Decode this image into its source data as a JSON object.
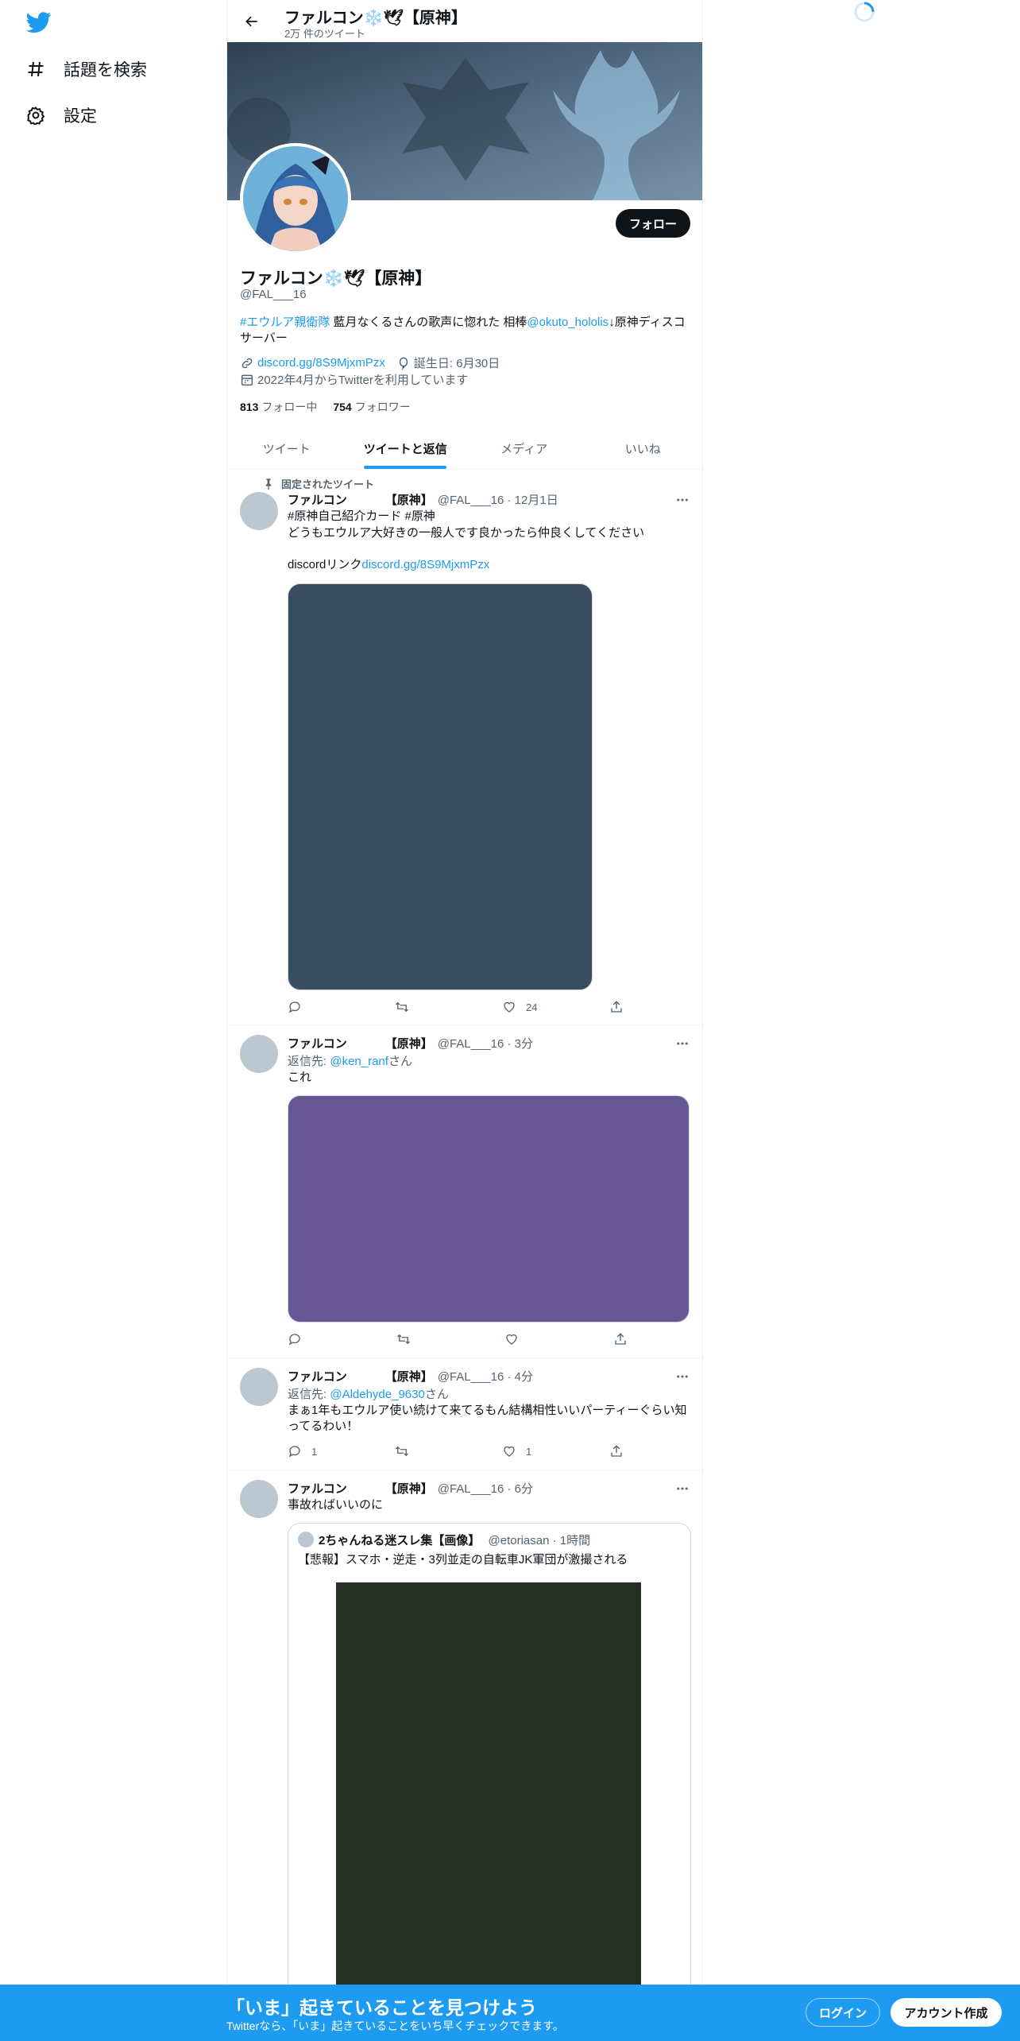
{
  "nav": {
    "logo_icon": "twitter-bird-icon",
    "items": [
      {
        "label": "話題を検索",
        "icon": "hashtag-icon"
      },
      {
        "label": "設定",
        "icon": "gear-icon"
      }
    ]
  },
  "header": {
    "name": "ファルコン❄️🕊【原神】",
    "tweet_count": "2万 件のツイート"
  },
  "profile": {
    "display_name": "ファルコン❄️🕊【原神】",
    "handle": "@FAL___16",
    "follow_label": "フォロー",
    "bio": {
      "hashtag": "#エウルア親衛隊",
      "text1": " 藍月なくるさんの歌声に惚れた 相棒",
      "mention": "@okuto_hololis",
      "text2": "↓原神ディスコサーバー"
    },
    "link": "discord.gg/8S9MjxmPzx",
    "birthday": "誕生日: 6月30日",
    "joined": "2022年4月からTwitterを利用しています",
    "following_count": "813",
    "following_label": "フォロー中",
    "followers_count": "754",
    "followers_label": "フォロワー"
  },
  "tabs": [
    {
      "label": "ツイート"
    },
    {
      "label": "ツイートと返信"
    },
    {
      "label": "メディア"
    },
    {
      "label": "いいね"
    }
  ],
  "tweets": [
    {
      "pinned_label": "固定されたツイート",
      "name": "ファルコン",
      "name_suffix": "【原神】",
      "meta": "@FAL___16 · 12月1日",
      "hashtags": "#原神自己紹介カード  #原神",
      "text": "どうもエウルア大好きの一般人です良かったら仲良くしてください",
      "text2_prefix": "discordリンク",
      "text2_link": "discord.gg/8S9MjxmPzx",
      "media_color": "#3a4d60",
      "reply_count": "",
      "retweet_count": "",
      "like_count": "24"
    },
    {
      "name": "ファルコン",
      "name_suffix": "【原神】",
      "meta": "@FAL___16 · 3分",
      "reply_prefix": "返信先: ",
      "reply_to": "@ken_ranf",
      "reply_suffix": "さん",
      "text": "これ",
      "media_color": "#675794",
      "like_count": ""
    },
    {
      "name": "ファルコン",
      "name_suffix": "【原神】",
      "meta": "@FAL___16 · 4分",
      "reply_prefix": "返信先: ",
      "reply_to": "@Aldehyde_9630",
      "reply_suffix": "さん",
      "text": "まぁ1年もエウルア使い続けて来てるもん結構相性いいパーティーぐらい知ってるわい！",
      "reply_count": "1",
      "like_count": "1"
    },
    {
      "name": "ファルコン",
      "name_suffix": "【原神】",
      "meta": "@FAL___16 · 6分",
      "text": "事故ればいいのに",
      "quote": {
        "name": "2ちゃんねる迷スレ集【画像】",
        "meta": "@etoriasan · 1時間",
        "text": "【悲報】スマホ・逆走・3列並走の自転車JK軍団が激撮される",
        "media_color": "#272f26"
      }
    }
  ],
  "bottom_bar": {
    "title": "「いま」起きていることを見つけよう",
    "subtitle": "Twitterなら、「いま」起きていることをいち早くチェックできます。",
    "login_label": "ログイン",
    "signup_label": "アカウント作成"
  },
  "colors": {
    "accent": "#1d9bf0",
    "text": "#0f1419",
    "secondary": "#536471"
  }
}
